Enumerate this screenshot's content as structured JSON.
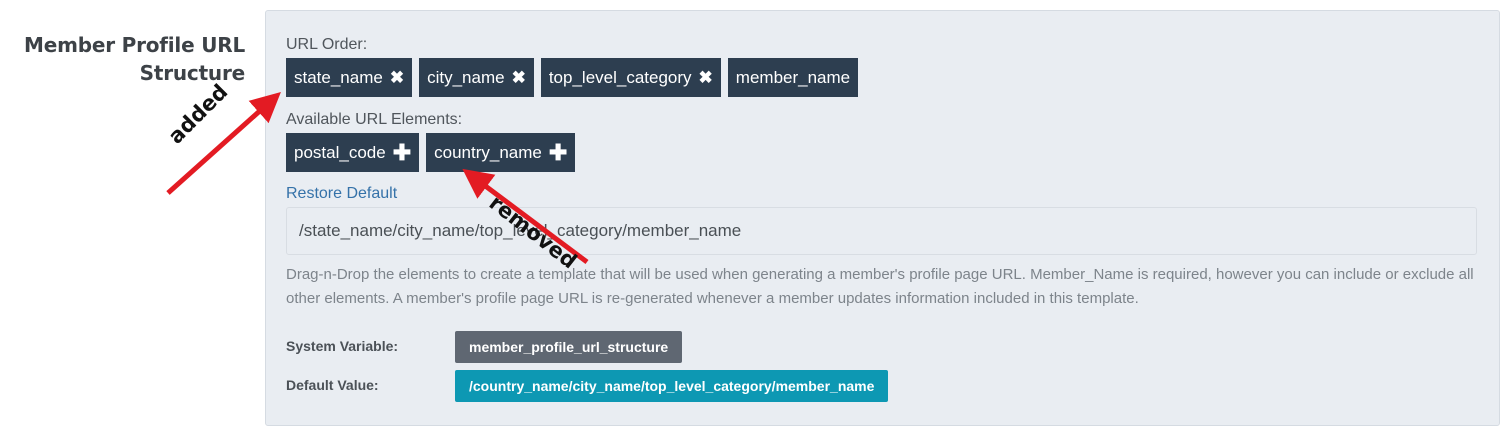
{
  "field": {
    "label": "Member Profile URL Structure"
  },
  "url_order": {
    "label": "URL Order:",
    "chips": [
      {
        "text": "state_name",
        "icon": "✖",
        "icon_name": "remove-icon"
      },
      {
        "text": "city_name",
        "icon": "✖",
        "icon_name": "remove-icon"
      },
      {
        "text": "top_level_category",
        "icon": "✖",
        "icon_name": "remove-icon"
      },
      {
        "text": "member_name"
      }
    ]
  },
  "available": {
    "label": "Available URL Elements:",
    "chips": [
      {
        "text": "postal_code",
        "icon": "✚",
        "icon_name": "add-icon"
      },
      {
        "text": "country_name",
        "icon": "✚",
        "icon_name": "add-icon"
      }
    ]
  },
  "restore_default": "Restore Default",
  "url_preview": "/state_name/city_name/top_level_category/member_name",
  "help_text": "Drag-n-Drop the elements to create a template that will be used when generating a member's profile page URL. Member_Name is required, however you can include or exclude all other elements. A member's profile page URL is re-generated whenever a member updates information included in this template.",
  "system_variable": {
    "label": "System Variable:",
    "value": "member_profile_url_structure"
  },
  "default_value": {
    "label": "Default Value:",
    "value": "/country_name/city_name/top_level_category/member_name"
  },
  "annotations": {
    "added": "added",
    "removed": "removed",
    "arrow_color": "#e31b23"
  },
  "colors": {
    "chip_bg": "#2d3e50",
    "badge_gray": "#5f6772",
    "badge_teal": "#0d98b3",
    "link": "#3572a9",
    "panel_bg": "#e9edf2"
  }
}
